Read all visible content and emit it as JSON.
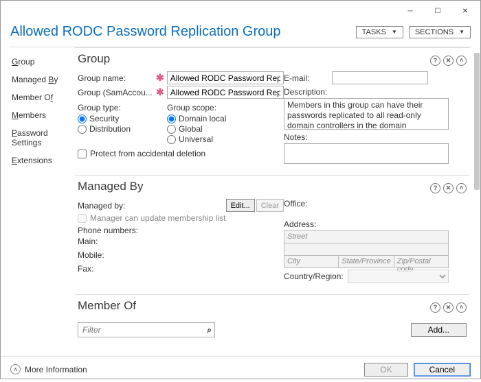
{
  "window": {
    "title": "Allowed RODC Password Replication Group",
    "tasks_btn": "TASKS",
    "sections_btn": "SECTIONS"
  },
  "sidebar": {
    "items": [
      {
        "label": "Group",
        "ul": "G"
      },
      {
        "label": "Managed By",
        "ul": "B"
      },
      {
        "label": "Member Of",
        "ul": "f"
      },
      {
        "label": "Members",
        "ul": "M"
      },
      {
        "label": "Password Settings",
        "ul": "P"
      },
      {
        "label": "Extensions",
        "ul": "E"
      }
    ]
  },
  "group": {
    "heading": "Group",
    "name_label": "Group name:",
    "name_value": "Allowed RODC Password Replica",
    "sam_label": "Group (SamAccou...",
    "sam_value": "Allowed RODC Password Replica",
    "type_label": "Group type:",
    "type_security": "Security",
    "type_distribution": "Distribution",
    "scope_label": "Group scope:",
    "scope_domain": "Domain local",
    "scope_global": "Global",
    "scope_universal": "Universal",
    "protect": "Protect from accidental deletion",
    "email_label": "E-mail:",
    "email_value": "",
    "desc_label": "Description:",
    "desc_value": "Members in this group can have their passwords replicated to all read-only domain controllers in the domain",
    "notes_label": "Notes:"
  },
  "managedby": {
    "heading": "Managed By",
    "managedby_label": "Managed by:",
    "edit_btn": "Edit...",
    "clear_btn": "Clear",
    "manager_update": "Manager can update membership list",
    "phone_label": "Phone numbers:",
    "main_label": "Main:",
    "mobile_label": "Mobile:",
    "fax_label": "Fax:",
    "office_label": "Office:",
    "address_label": "Address:",
    "street_ph": "Street",
    "city_ph": "City",
    "state_ph": "State/Province",
    "zip_ph": "Zip/Postal code",
    "country_label": "Country/Region:"
  },
  "memberof": {
    "heading": "Member Of",
    "filter_ph": "Filter",
    "add_btn": "Add..."
  },
  "footer": {
    "more_info": "More Information",
    "ok": "OK",
    "cancel": "Cancel"
  }
}
